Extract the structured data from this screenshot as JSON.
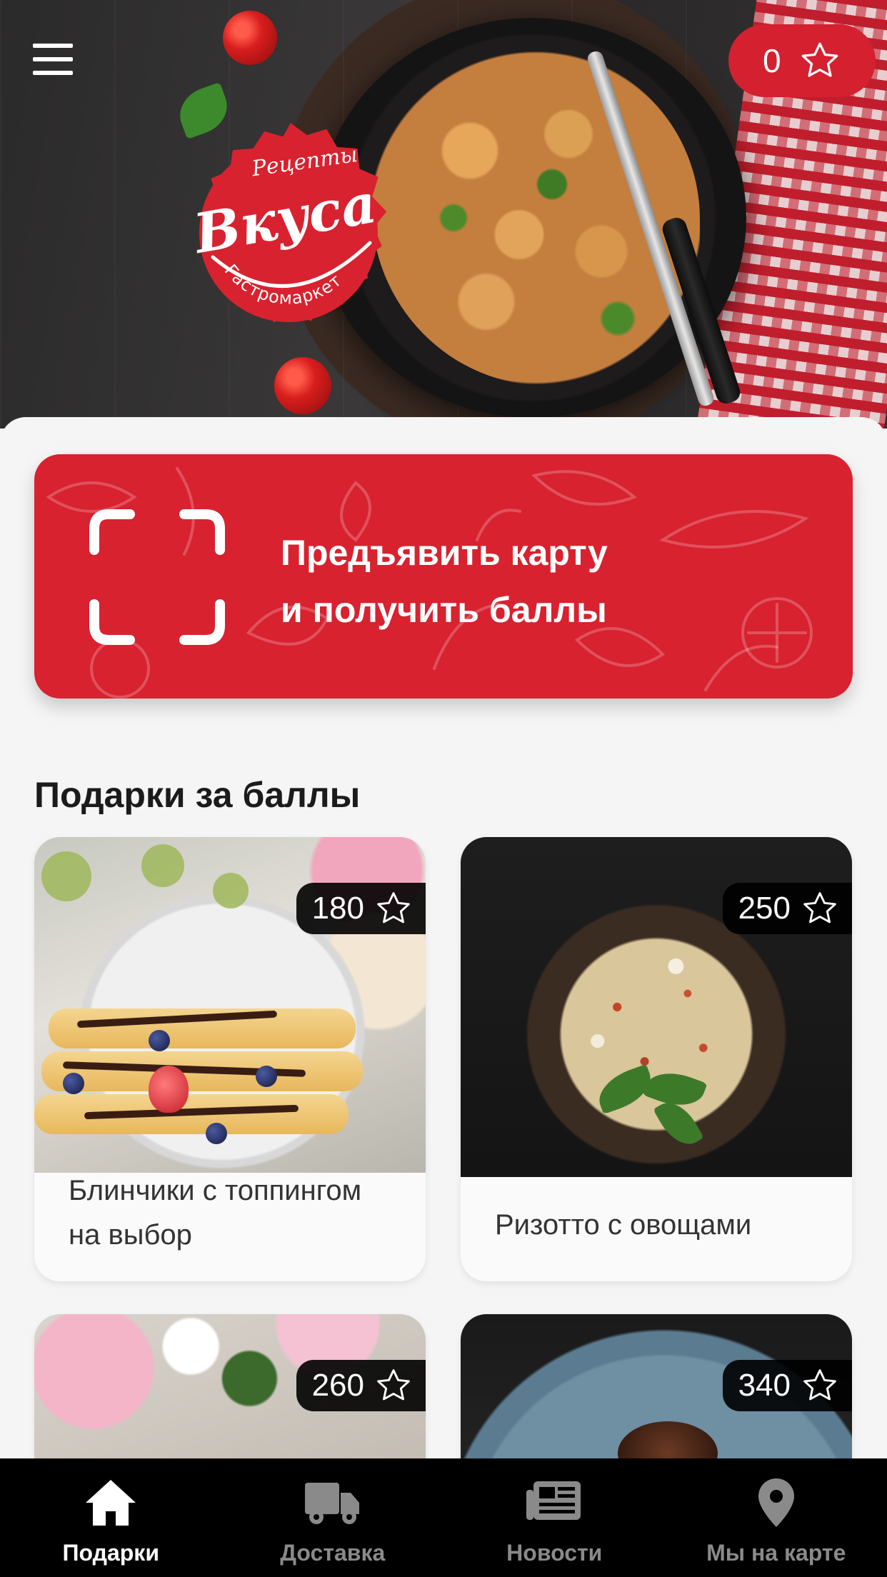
{
  "header": {
    "points_value": "0",
    "logo": {
      "top_text": "Рецепты",
      "main_text": "Вкуса",
      "bottom_text": "Гастромаркет"
    }
  },
  "promo": {
    "line1": "Предъявить карту",
    "line2": "и получить баллы"
  },
  "gifts_section": {
    "title": "Подарки за баллы",
    "items": [
      {
        "name": "Блинчики с топпингом на выбор",
        "points": "180"
      },
      {
        "name": "Ризотто с овощами",
        "points": "250"
      },
      {
        "name": "",
        "points": "260"
      },
      {
        "name": "",
        "points": "340"
      }
    ]
  },
  "bottom_nav": {
    "items": [
      {
        "label": "Подарки",
        "icon": "home-icon",
        "active": true
      },
      {
        "label": "Доставка",
        "icon": "truck-icon",
        "active": false
      },
      {
        "label": "Новости",
        "icon": "newspaper-icon",
        "active": false
      },
      {
        "label": "Мы на карте",
        "icon": "map-pin-icon",
        "active": false
      }
    ]
  },
  "colors": {
    "brand_red": "#d8222f",
    "nav_background": "#000000",
    "nav_active": "#ffffff",
    "nav_inactive": "#8a8a8a"
  }
}
